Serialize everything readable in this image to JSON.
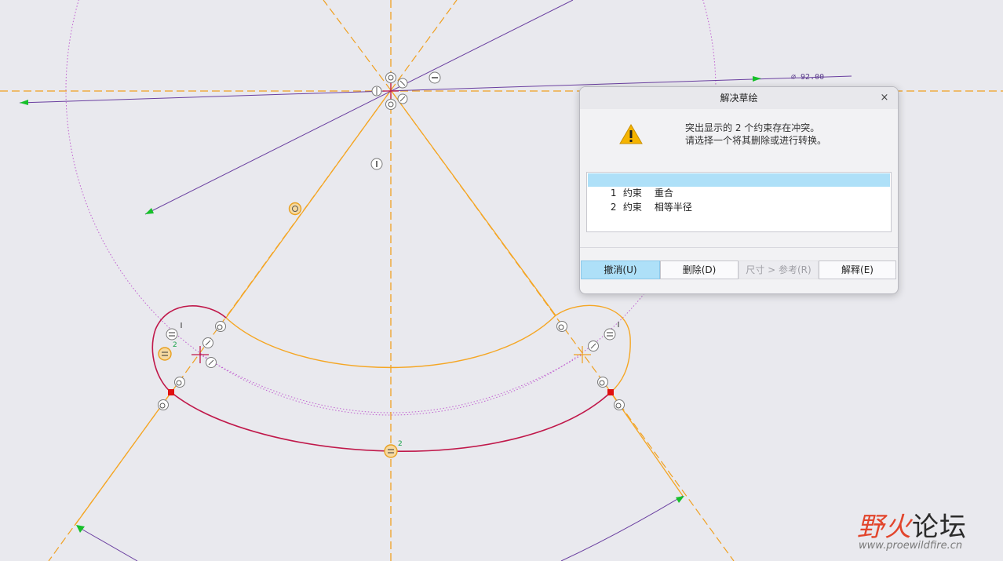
{
  "sketch": {
    "dimension_label": "⌀ 92.00",
    "constraint_marks": {
      "left_equal_index": "2",
      "bottom_equal_index": "2"
    },
    "colors": {
      "background": "#e9e9ee",
      "centerline": "#f0a020",
      "construction_circle": "#c060d0",
      "selected_arc": "#c0184a",
      "geometry_orange": "#f5a623",
      "dimension": "#6a3fa0",
      "arrow_green": "#17c02a",
      "conflict_marker": "#e01010"
    }
  },
  "dialog": {
    "title": "解决草绘",
    "close_glyph": "×",
    "icon": "warning-triangle-icon",
    "message_line1": "突出显示的 2 个约束存在冲突。",
    "message_line2": "请选择一个将其删除或进行转换。",
    "conflicts": [
      {
        "index": "1",
        "kind": "约束",
        "name": "重合",
        "selected": true
      },
      {
        "index": "2",
        "kind": "约束",
        "name": "相等半径",
        "selected": false
      }
    ],
    "buttons": {
      "undo": "撤消(U)",
      "delete": "删除(D)",
      "dim_to_ref": "尺寸 > 参考(R)",
      "explain": "解释(E)"
    }
  },
  "watermark": {
    "brand_a": "野火",
    "brand_b": "论坛",
    "url": "www.proewildfire.cn"
  }
}
